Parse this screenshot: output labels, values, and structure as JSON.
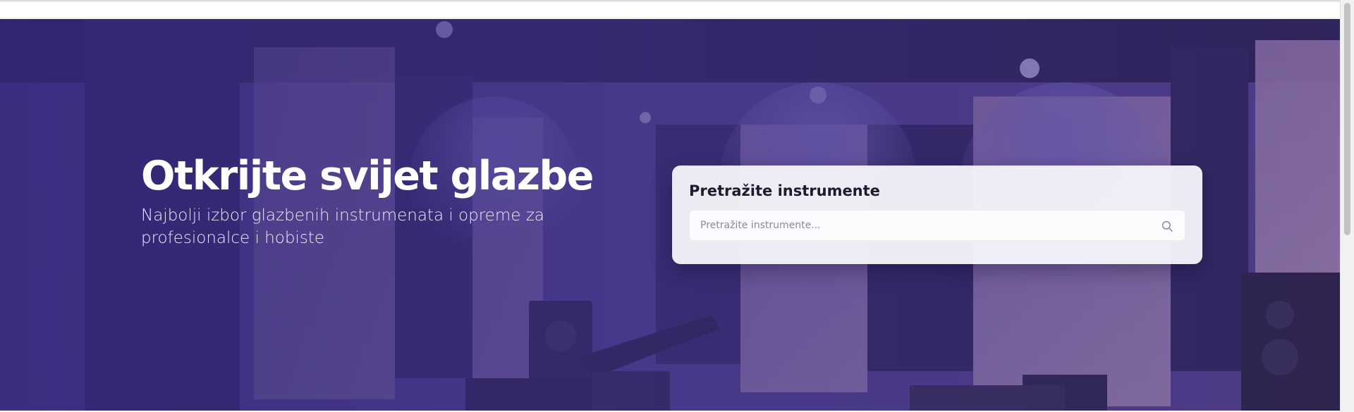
{
  "hero": {
    "title": "Otkrijte svijet glazbe",
    "subtitle": "Najbolji izbor glazbenih instrumenata i opreme za profesionalce i hobiste",
    "background": "music-studio-photo"
  },
  "search": {
    "title": "Pretražite instrumente",
    "placeholder": "Pretražite instrumente...",
    "icon": "search-icon"
  },
  "colors": {
    "overlay": "#35297d",
    "card": "#f6f6fb",
    "title_text": "#1f1b2e"
  }
}
